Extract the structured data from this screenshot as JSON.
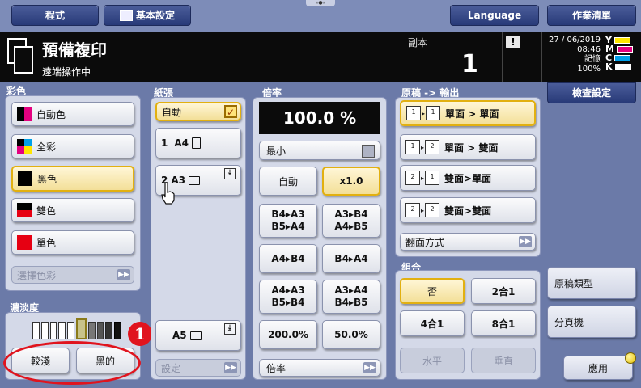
{
  "top_tabs": {
    "program": "程式",
    "basic_settings": "基本設定",
    "language": "Language",
    "job_list": "作業清單"
  },
  "header": {
    "title": "預備複印",
    "subtitle": "遠端操作中",
    "copies_label": "副本",
    "copies_value": "1",
    "warn_glyph": "!",
    "date": "27 / 06/2019",
    "time": "08:46",
    "memory_label": "記憶",
    "memory_value": "100%",
    "toner": [
      "Y",
      "M",
      "C",
      "K"
    ]
  },
  "color": {
    "label": "彩色",
    "items": [
      "自動色",
      "全彩",
      "黑色",
      "雙色",
      "單色"
    ],
    "select_label": "選擇色彩"
  },
  "density": {
    "label": "濃淡度",
    "lighter": "較淺",
    "darker": "黑的"
  },
  "paper": {
    "label": "紙張",
    "auto": "自動",
    "tray1": "1",
    "tray1_size": "A4",
    "tray2": "2",
    "tray2_size": "A3",
    "tray5_size": "A5",
    "settings": "設定"
  },
  "zoom": {
    "label": "倍率",
    "value": "100.0 %",
    "min": "最小",
    "auto": "自動",
    "x1": "x1.0",
    "p1a": "B4▸A3",
    "p1b": "B5▸A4",
    "p2a": "A3▸B4",
    "p2b": "A4▸B5",
    "p3": "A4▸B4",
    "p4": "B4▸A4",
    "p5a": "A4▸A3",
    "p5b": "B5▸B4",
    "p6a": "A3▸A4",
    "p6b": "B4▸B5",
    "p7": "200.0%",
    "p8": "50.0%",
    "more": "倍率"
  },
  "original": {
    "label": "原稿 -> 輸出",
    "items": [
      "單面 > 單面",
      "單面 > 雙面",
      "雙面>單面",
      "雙面>雙面"
    ],
    "flip": "翻面方式"
  },
  "combine": {
    "label": "組合",
    "no": "否",
    "two": "2合1",
    "four": "4合1",
    "eight": "8合1",
    "horizontal": "水平",
    "vertical": "垂直"
  },
  "side": {
    "check": "檢查設定",
    "original_type": "原稿類型",
    "finishing": "分頁機",
    "apply": "應用"
  },
  "annotation": {
    "number": "1"
  },
  "colors": {
    "accent": "#e2b010",
    "annotation_red": "#e0141e",
    "header_bg": "#0b0b0b",
    "panel_bg": "#d4d9e8"
  }
}
